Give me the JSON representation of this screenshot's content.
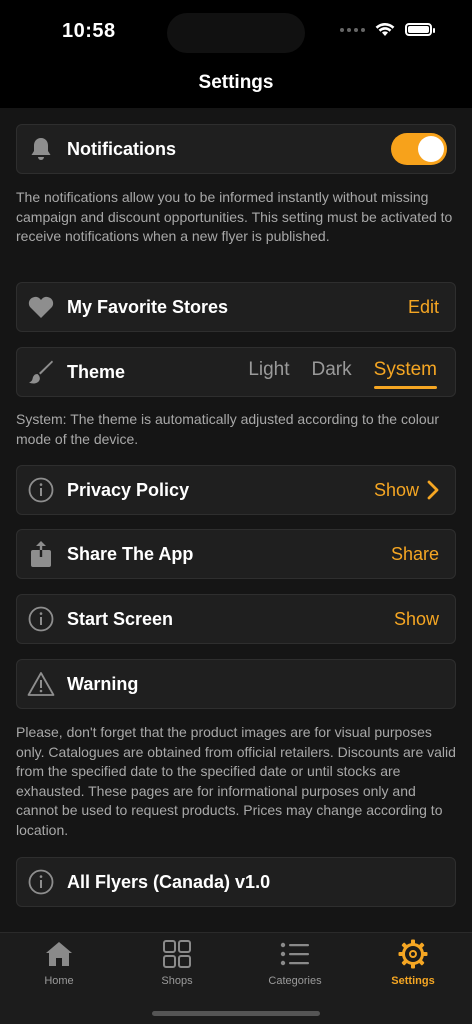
{
  "status_bar": {
    "time": "10:58"
  },
  "nav": {
    "title": "Settings"
  },
  "notifications": {
    "label": "Notifications",
    "enabled": true,
    "description": "The notifications allow you to be informed instantly without missing campaign and discount opportunities. This setting must be activated to receive notifications when a new flyer is published."
  },
  "favorites": {
    "label": "My Favorite Stores",
    "action": "Edit"
  },
  "theme": {
    "label": "Theme",
    "options": [
      "Light",
      "Dark",
      "System"
    ],
    "selected": "System",
    "description": "System: The theme is automatically adjusted according to the colour mode of the device."
  },
  "privacy": {
    "label": "Privacy Policy",
    "action": "Show"
  },
  "share": {
    "label": "Share The App",
    "action": "Share"
  },
  "start_screen": {
    "label": "Start Screen",
    "action": "Show"
  },
  "warning": {
    "label": "Warning",
    "description": "Please, don't forget that the product images are for visual purposes only. Catalogues are obtained from official retailers. Discounts are valid from the specified date to the specified date or until stocks are exhausted. These pages are for informational purposes only and cannot be used to request products. Prices may change according to location."
  },
  "version": {
    "label": "All Flyers (Canada) v1.0"
  },
  "tabs": [
    {
      "label": "Home",
      "icon": "home-icon"
    },
    {
      "label": "Shops",
      "icon": "grid-icon"
    },
    {
      "label": "Categories",
      "icon": "list-icon"
    },
    {
      "label": "Settings",
      "icon": "gear-icon",
      "active": true
    }
  ],
  "colors": {
    "accent": "#f5a623",
    "background": "#151515",
    "card": "#1f1f1f"
  }
}
